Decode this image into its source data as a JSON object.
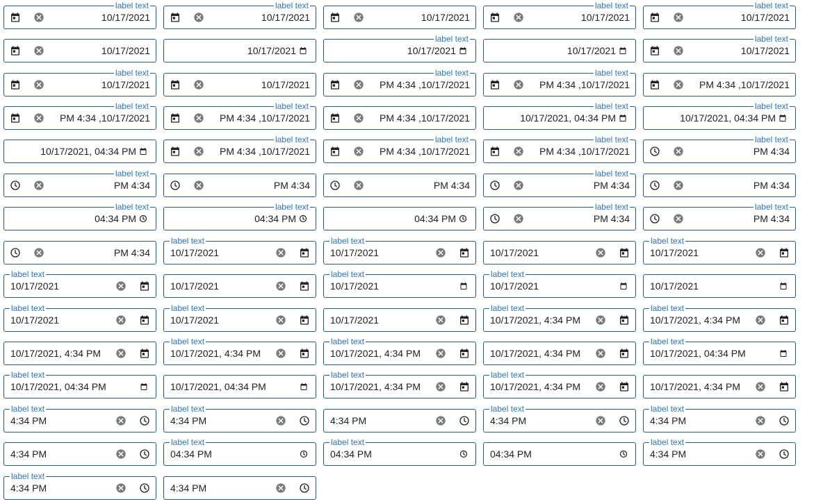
{
  "label": "label text",
  "rows": [
    [
      {
        "layout": "rtl-ic",
        "label": true,
        "value": "10/17/2021"
      },
      {
        "layout": "rtl-ic",
        "label": true,
        "value": "10/17/2021"
      },
      {
        "layout": "rtl-ic",
        "label": false,
        "value": "10/17/2021"
      },
      {
        "layout": "rtl-ic",
        "label": true,
        "value": "10/17/2021"
      },
      {
        "layout": "rtl-ic",
        "label": true,
        "value": "10/17/2021"
      }
    ],
    [
      {
        "layout": "rtl-ic",
        "label": false,
        "value": "10/17/2021"
      },
      {
        "layout": "rtl-native",
        "label": false,
        "value": "10/17/2021"
      },
      {
        "layout": "rtl-native",
        "label": true,
        "value": "10/17/2021"
      },
      {
        "layout": "rtl-native",
        "label": false,
        "value": "10/17/2021"
      },
      {
        "layout": "rtl-ic",
        "label": true,
        "value": "10/17/2021"
      }
    ],
    [
      {
        "layout": "rtl-ic",
        "label": true,
        "value": "10/17/2021"
      },
      {
        "layout": "rtl-ic",
        "label": false,
        "value": "10/17/2021"
      },
      {
        "layout": "rtl-ic",
        "label": true,
        "value": "PM 4:34 ,10/17/2021"
      },
      {
        "layout": "rtl-ic",
        "label": true,
        "value": "PM 4:34 ,10/17/2021"
      },
      {
        "layout": "rtl-ic",
        "label": false,
        "value": "PM 4:34 ,10/17/2021"
      }
    ],
    [
      {
        "layout": "rtl-ic",
        "label": true,
        "value": "PM 4:34 ,10/17/2021"
      },
      {
        "layout": "rtl-ic",
        "label": true,
        "value": "PM 4:34 ,10/17/2021"
      },
      {
        "layout": "rtl-ic",
        "label": false,
        "value": "PM 4:34 ,10/17/2021"
      },
      {
        "layout": "rtl-native",
        "label": true,
        "value": "10/17/2021, 04:34 PM"
      },
      {
        "layout": "rtl-native",
        "label": true,
        "value": "10/17/2021, 04:34 PM"
      }
    ],
    [
      {
        "layout": "rtl-native",
        "label": false,
        "value": "10/17/2021, 04:34 PM"
      },
      {
        "layout": "rtl-ic",
        "label": true,
        "value": "PM 4:34 ,10/17/2021"
      },
      {
        "layout": "rtl-ic",
        "label": true,
        "value": "PM 4:34 ,10/17/2021"
      },
      {
        "layout": "rtl-ic",
        "label": true,
        "value": "PM 4:34 ,10/17/2021"
      },
      {
        "layout": "rtl-ic-time",
        "label": true,
        "value": "PM 4:34"
      }
    ],
    [
      {
        "layout": "rtl-ic-time",
        "label": true,
        "value": "PM 4:34"
      },
      {
        "layout": "rtl-ic-time",
        "label": false,
        "value": "PM 4:34"
      },
      {
        "layout": "rtl-ic-time",
        "label": false,
        "value": "PM 4:34"
      },
      {
        "layout": "rtl-ic-time",
        "label": true,
        "value": "PM 4:34"
      },
      {
        "layout": "rtl-ic-time",
        "label": false,
        "value": "PM 4:34"
      }
    ],
    [
      {
        "layout": "rtl-native-time",
        "label": true,
        "value": "04:34 PM"
      },
      {
        "layout": "rtl-native-time",
        "label": true,
        "value": "04:34 PM"
      },
      {
        "layout": "rtl-native-time",
        "label": false,
        "value": "04:34 PM"
      },
      {
        "layout": "rtl-ic-time",
        "label": true,
        "value": "PM 4:34"
      },
      {
        "layout": "rtl-ic-time",
        "label": true,
        "value": "PM 4:34"
      }
    ],
    [
      {
        "layout": "rtl-ic-time",
        "label": false,
        "value": "PM 4:34"
      },
      {
        "layout": "ltr-ic",
        "label": true,
        "value": "10/17/2021"
      },
      {
        "layout": "ltr-ic",
        "label": true,
        "value": "10/17/2021"
      },
      {
        "layout": "ltr-ic",
        "label": false,
        "value": "10/17/2021"
      },
      {
        "layout": "ltr-ic",
        "label": true,
        "value": "10/17/2021"
      }
    ],
    [
      {
        "layout": "ltr-ic",
        "label": true,
        "value": "10/17/2021"
      },
      {
        "layout": "ltr-ic",
        "label": false,
        "value": "10/17/2021"
      },
      {
        "layout": "ltr-native",
        "label": true,
        "value": "10/17/2021"
      },
      {
        "layout": "ltr-native",
        "label": true,
        "value": "10/17/2021"
      },
      {
        "layout": "ltr-native",
        "label": false,
        "value": "10/17/2021"
      }
    ],
    [
      {
        "layout": "ltr-ic",
        "label": true,
        "value": "10/17/2021"
      },
      {
        "layout": "ltr-ic",
        "label": true,
        "value": "10/17/2021"
      },
      {
        "layout": "ltr-ic",
        "label": false,
        "value": "10/17/2021"
      },
      {
        "layout": "ltr-ic",
        "label": true,
        "value": "10/17/2021, 4:34 PM"
      },
      {
        "layout": "ltr-ic",
        "label": true,
        "value": "10/17/2021, 4:34 PM"
      }
    ],
    [
      {
        "layout": "ltr-ic",
        "label": false,
        "value": "10/17/2021, 4:34 PM"
      },
      {
        "layout": "ltr-ic",
        "label": true,
        "value": "10/17/2021, 4:34 PM"
      },
      {
        "layout": "ltr-ic",
        "label": true,
        "value": "10/17/2021, 4:34 PM"
      },
      {
        "layout": "ltr-ic",
        "label": false,
        "value": "10/17/2021, 4:34 PM"
      },
      {
        "layout": "ltr-native",
        "label": true,
        "value": "10/17/2021, 04:34 PM"
      }
    ],
    [
      {
        "layout": "ltr-native",
        "label": true,
        "value": "10/17/2021, 04:34 PM"
      },
      {
        "layout": "ltr-native",
        "label": false,
        "value": "10/17/2021, 04:34 PM"
      },
      {
        "layout": "ltr-ic",
        "label": true,
        "value": "10/17/2021, 4:34 PM"
      },
      {
        "layout": "ltr-ic",
        "label": true,
        "value": "10/17/2021, 4:34 PM"
      },
      {
        "layout": "ltr-ic",
        "label": false,
        "value": "10/17/2021, 4:34 PM"
      }
    ],
    [
      {
        "layout": "ltr-ic-time",
        "label": true,
        "value": "4:34 PM"
      },
      {
        "layout": "ltr-ic-time",
        "label": true,
        "value": "4:34 PM"
      },
      {
        "layout": "ltr-ic-time",
        "label": false,
        "value": "4:34 PM"
      },
      {
        "layout": "ltr-ic-time",
        "label": true,
        "value": "4:34 PM"
      },
      {
        "layout": "ltr-ic-time",
        "label": true,
        "value": "4:34 PM"
      }
    ],
    [
      {
        "layout": "ltr-ic-time",
        "label": false,
        "value": "4:34 PM"
      },
      {
        "layout": "ltr-native-time",
        "label": true,
        "value": "04:34 PM"
      },
      {
        "layout": "ltr-native-time",
        "label": true,
        "value": "04:34 PM"
      },
      {
        "layout": "ltr-native-time",
        "label": false,
        "value": "04:34 PM"
      },
      {
        "layout": "ltr-ic-time",
        "label": true,
        "value": "4:34 PM"
      }
    ],
    [
      {
        "layout": "ltr-ic-time",
        "label": true,
        "value": "4:34 PM"
      },
      {
        "layout": "ltr-ic-time",
        "label": false,
        "value": "4:34 PM"
      }
    ]
  ]
}
